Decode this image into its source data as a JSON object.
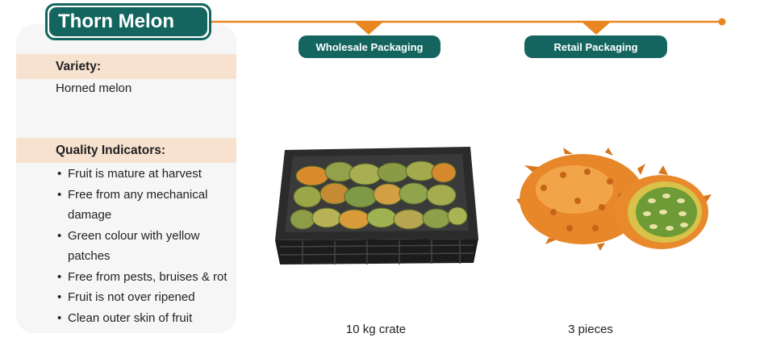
{
  "header": {
    "title": "Thorn Melon"
  },
  "colors": {
    "brand_teal": "#14655f",
    "accent_orange": "#e9861f",
    "section_band": "#f7e2d0",
    "panel_bg": "#f6f6f6"
  },
  "variety": {
    "heading": "Variety:",
    "value": "Horned melon"
  },
  "quality": {
    "heading": "Quality Indicators:",
    "items": [
      "Fruit is mature at harvest",
      "Free from any mechanical",
      "damage",
      "Green colour with yellow",
      "patches",
      "Free from pests, bruises & rot",
      "Fruit is not over ripened",
      "Clean outer skin of fruit"
    ]
  },
  "packaging": {
    "wholesale": {
      "label": "Wholesale Packaging",
      "caption": "10 kg crate",
      "image_icon": "melon-crate-image"
    },
    "retail": {
      "label": "Retail Packaging",
      "caption": "3 pieces",
      "image_icon": "horned-melon-image"
    }
  }
}
